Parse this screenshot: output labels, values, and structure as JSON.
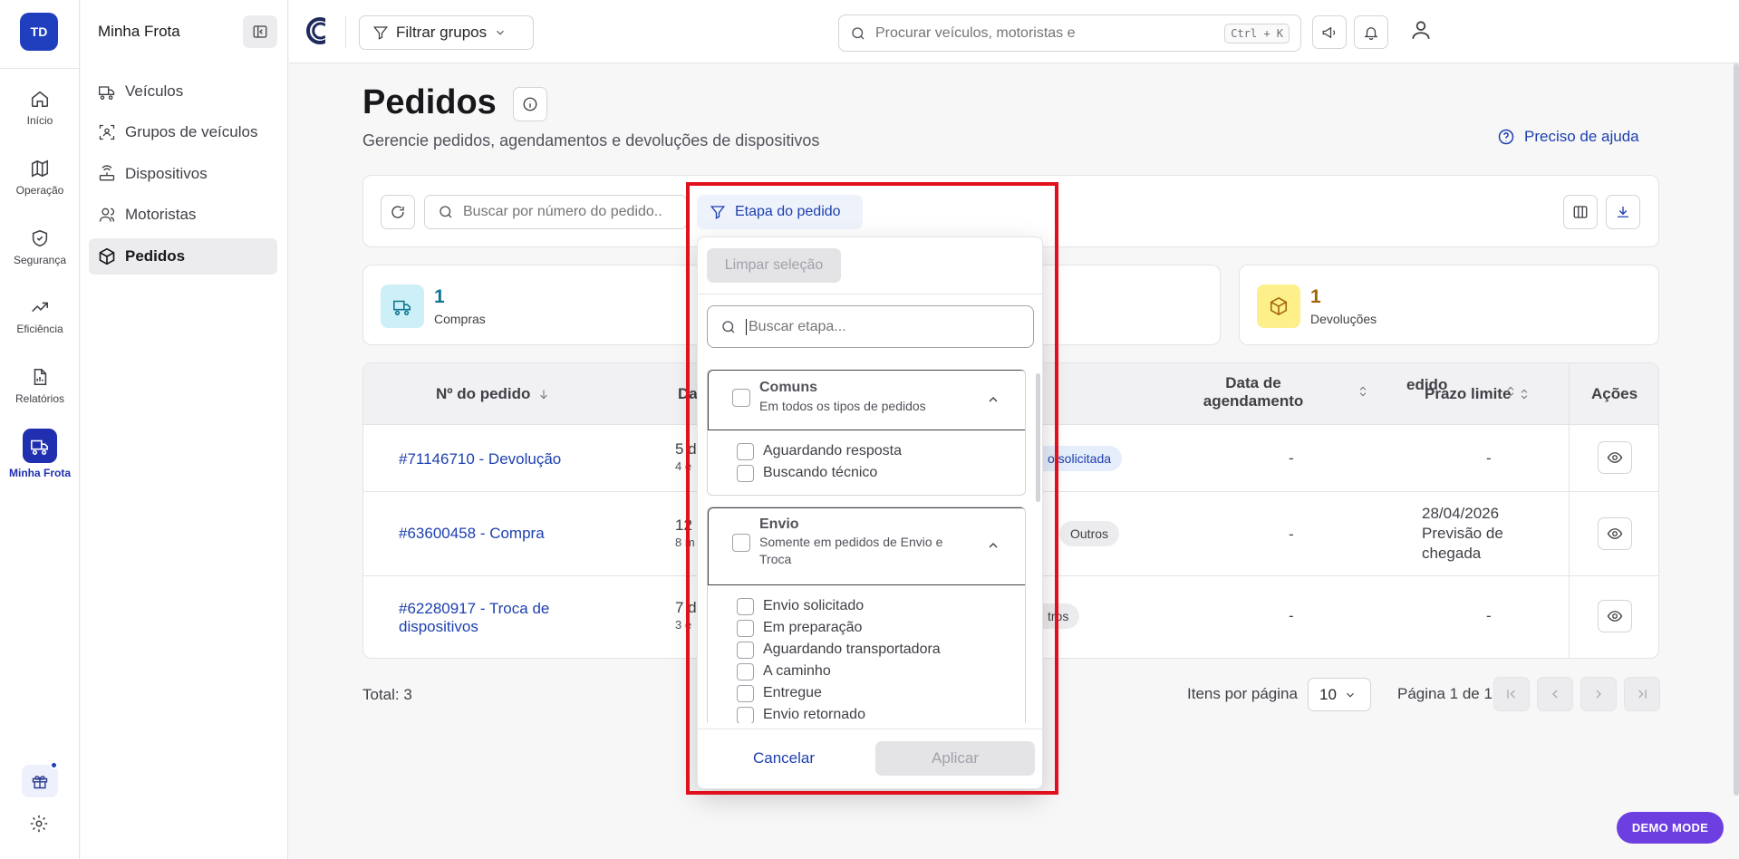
{
  "rail": {
    "avatar": "TD",
    "items": [
      {
        "label": "Início",
        "icon": "home-icon"
      },
      {
        "label": "Operação",
        "icon": "map-icon"
      },
      {
        "label": "Segurança",
        "icon": "shield-icon"
      },
      {
        "label": "Eficiência",
        "icon": "trending-up-icon"
      },
      {
        "label": "Relatórios",
        "icon": "report-icon"
      },
      {
        "label": "Minha Frota",
        "icon": "truck-icon"
      }
    ]
  },
  "sidebar": {
    "title": "Minha Frota",
    "items": [
      {
        "label": "Veículos",
        "icon": "truck-icon"
      },
      {
        "label": "Grupos de veículos",
        "icon": "group-scan-icon"
      },
      {
        "label": "Dispositivos",
        "icon": "device-icon"
      },
      {
        "label": "Motoristas",
        "icon": "users-icon"
      },
      {
        "label": "Pedidos",
        "icon": "package-icon",
        "active": true
      }
    ]
  },
  "header": {
    "filter_groups": "Filtrar grupos",
    "search_placeholder": "Procurar veículos, motoristas e",
    "shortcut": "Ctrl + K"
  },
  "page": {
    "title": "Pedidos",
    "subtitle": "Gerencie pedidos, agendamentos e devoluções de dispositivos",
    "help": "Preciso de ajuda"
  },
  "toolbar": {
    "order_search_placeholder": "Buscar por número do pedido..",
    "stage_filter": "Etapa do pedido"
  },
  "stats": [
    {
      "value": "1",
      "label": "Compras"
    },
    {
      "value": "1",
      "label": "Devoluções"
    }
  ],
  "table": {
    "headers": {
      "order_no": "Nº do pedido",
      "d_partial": "Da",
      "type_partial": "edido",
      "schedule": "Data de agendamento",
      "deadline": "Prazo limite",
      "actions": "Ações"
    },
    "rows": [
      {
        "order": "#71146710 - Devolução",
        "col2_line1": "5 d",
        "col2_line2": "4 e",
        "badge": "o solicitada",
        "schedule": "-",
        "deadline": "-"
      },
      {
        "order": "#63600458 - Compra",
        "col2_line1": "12 d",
        "col2_line2": "8 m",
        "badge": "Outros",
        "schedule": "-",
        "deadline": "28/04/2026 Previsão de chegada"
      },
      {
        "order": "#62280917 - Troca de dispositivos",
        "col2_line1": "7 d",
        "col2_line2": "3 e",
        "badge": "tros",
        "schedule": "-",
        "deadline": "-"
      }
    ]
  },
  "footer": {
    "total": "Total: 3",
    "items_per_page_label": "Itens por página",
    "items_per_page": "10",
    "page_info": "Página 1 de 1"
  },
  "dropdown": {
    "clear": "Limpar seleção",
    "search_placeholder": "Buscar etapa...",
    "groups": [
      {
        "title": "Comuns",
        "description": "Em todos os tipos de pedidos",
        "options": [
          "Aguardando resposta",
          "Buscando técnico"
        ]
      },
      {
        "title": "Envio",
        "description": "Somente em pedidos de Envio e Troca",
        "options": [
          "Envio solicitado",
          "Em preparação",
          "Aguardando transportadora",
          "A caminho",
          "Entregue",
          "Envio retornado"
        ]
      }
    ],
    "cancel": "Cancelar",
    "apply": "Aplicar"
  },
  "demo_mode": "DEMO MODE",
  "colors": {
    "brand": "#1f3fbf",
    "link": "#1e40af",
    "highlight": "#e0101c",
    "demo": "#6d3fe0"
  }
}
